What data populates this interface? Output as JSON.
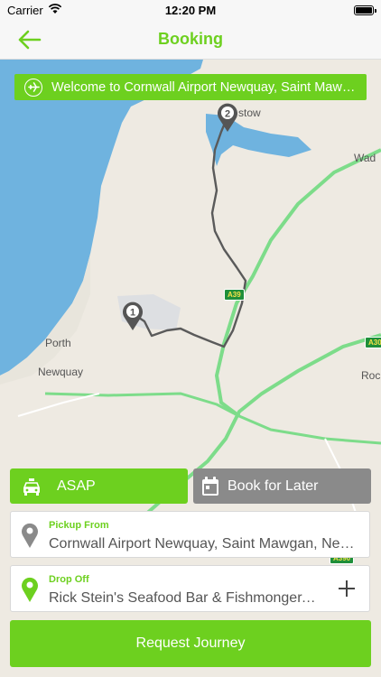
{
  "status_bar": {
    "carrier": "Carrier",
    "time": "12:20 PM"
  },
  "nav": {
    "title": "Booking",
    "back_icon": "arrow-left-icon"
  },
  "banner": {
    "icon": "airplane-icon",
    "text": "Welcome to Cornwall Airport Newquay, Saint Mawgan"
  },
  "map": {
    "labels": {
      "porth": "Porth",
      "newquay": "Newquay",
      "padstow": "stow",
      "wadebridge": "Wad",
      "roche": "Roc"
    },
    "road_badges": {
      "a39": "A39",
      "a30": "A30",
      "a390": "A390"
    },
    "pins": {
      "pickup": "1",
      "dropoff": "2"
    }
  },
  "buttons": {
    "asap": "ASAP",
    "book_later": "Book for Later",
    "request": "Request Journey"
  },
  "pickup": {
    "label": "Pickup From",
    "value": "Cornwall Airport Newquay, Saint Mawgan, Newquay"
  },
  "dropoff": {
    "label": "Drop Off",
    "value": "Rick Stein's Seafood Bar & Fishmonger, Padstow"
  },
  "colors": {
    "accent": "#6dd01f",
    "secondary": "#8a8a8a",
    "route": "#5a5a5a",
    "sea": "#6fb3df",
    "road": "#7ddc8a"
  }
}
